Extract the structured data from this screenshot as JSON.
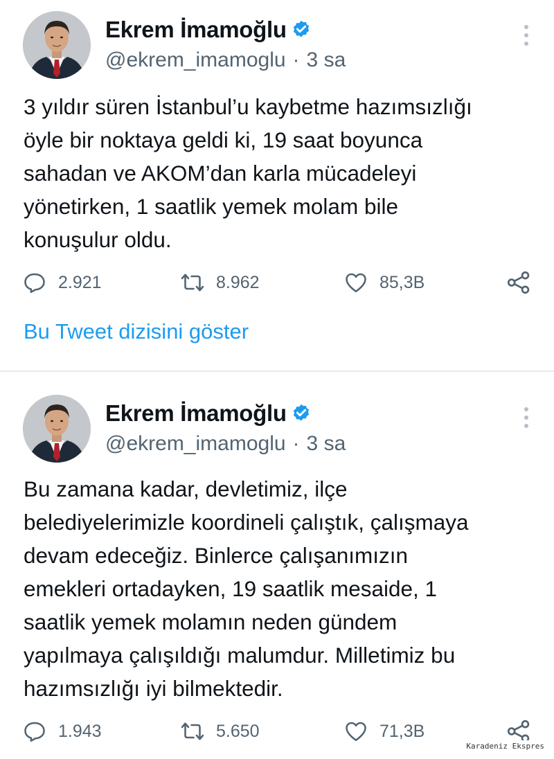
{
  "tweets": [
    {
      "author_name": "Ekrem İmamoğlu",
      "handle": "@ekrem_imamoglu",
      "separator": "·",
      "time": "3 sa",
      "verified": true,
      "text": "3 yıldır süren İstanbul’u kaybetme hazımsızlığı\nöyle bir noktaya geldi ki, 19 saat boyunca\nsahadan ve AKOM’dan karla mücadeleyi\nyönetirken, 1 saatlik yemek molam bile\nkonuşulur oldu.",
      "replies": "2.921",
      "retweets": "8.962",
      "likes": "85,3B",
      "thread_link": "Bu Tweet dizisini göster"
    },
    {
      "author_name": "Ekrem İmamoğlu",
      "handle": "@ekrem_imamoglu",
      "separator": "·",
      "time": "3 sa",
      "verified": true,
      "text": "Bu zamana kadar, devletimiz, ilçe\nbelediyelerimizle koordineli çalıştık, çalışmaya\ndevam edeceğiz. Binlerce çalışanımızın\nemekleri ortadayken, 19 saatlik mesaide, 1\nsaatlik yemek molamın neden gündem\nyapılmaya çalışıldığı malumdur. Milletimiz bu\nhazımsızlığı iyi bilmektedir.",
      "replies": "1.943",
      "retweets": "5.650",
      "likes": "71,3B"
    }
  ],
  "icons": {
    "reply": "reply-icon",
    "retweet": "retweet-icon",
    "like": "heart-icon",
    "share": "share-icon",
    "more": "more-vertical-icon",
    "verified": "verified-badge-icon"
  },
  "colors": {
    "link": "#1d9bf0",
    "verified": "#1d9bf0",
    "secondary_text": "#536471",
    "primary_text": "#0f1419",
    "divider": "#e6e9ec"
  },
  "watermark": "Karadeniz Ekspres"
}
